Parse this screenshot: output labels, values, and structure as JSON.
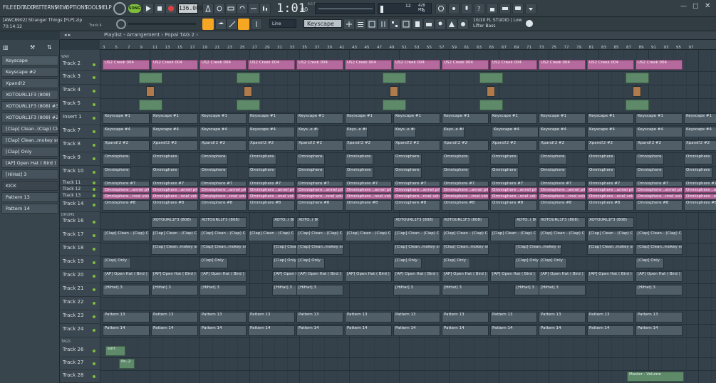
{
  "menu": [
    "FILE",
    "EDIT",
    "ADD",
    "PATTERNS",
    "VIEW",
    "OPTIONS",
    "TOOLS",
    "HELP"
  ],
  "transport": {
    "mode": "SONG",
    "tempo": "136.000",
    "time": "1:01",
    "time_sub": "00",
    "bst": "B:S:T"
  },
  "monitor": {
    "cpu": "12",
    "mem": "428 MB",
    "poly": "0"
  },
  "project": {
    "file": "[AWC8902] Stranger Things [FLP].zip",
    "time": "70:14:12",
    "track_hint": "Track 4"
  },
  "snap": "Line",
  "pattern": "Keyscape",
  "news": {
    "line1": "10/10 FL STUDIO | Low",
    "line2": "Lifter Bass"
  },
  "playlist_title": "Playlist - Arrangement › Popai TAG 2 ›",
  "browser_items": [
    "Keyscape",
    "Keyscape #2",
    "Xpand!2",
    "XOTOURL1F3 (808)",
    "XOTOURL1F3 (808) #3",
    "XOTOURL1F3 (808) #2",
    "[Clap] Clean..(Clap) Clean",
    "[Clap] Clean..mokey snare",
    "[Clap] Only",
    "[AP] Open Hat ( Bird )",
    "[HiHat] 3",
    "KICK",
    "Pattern 13",
    "Pattern 14"
  ],
  "ruler": [
    "3",
    "5",
    "7",
    "9",
    "11",
    "13",
    "15",
    "17",
    "19",
    "21",
    "23",
    "25",
    "27",
    "29",
    "31",
    "33",
    "35",
    "37",
    "39",
    "41",
    "43",
    "45",
    "47",
    "49",
    "51",
    "53",
    "55",
    "57",
    "59",
    "61",
    "63",
    "65",
    "67",
    "69",
    "71",
    "73",
    "75",
    "77",
    "79",
    "81",
    "83",
    "85",
    "87",
    "89",
    "91",
    "93",
    "95",
    "97"
  ],
  "sections": {
    "wav": "WAV",
    "drums": "DRUMS",
    "tags": "TAGS"
  },
  "tracks": [
    "Track 2",
    "Track 3",
    "Track 4",
    "Track 5",
    "Insert 1",
    "Track 7",
    "Track 8",
    "Track 9",
    "Track 10",
    "Track 11",
    "Track 12",
    "Track 13",
    "Track 14",
    "Track 16",
    "Track 17",
    "Track 18",
    "Track 19",
    "Track 20",
    "Track 21",
    "Track 22",
    "Track 23",
    "Track 24",
    "Track 26",
    "Track 27",
    "Track 28"
  ],
  "clips": {
    "t2": "US2 Creek 004",
    "ins1": "Keyscape #1",
    "t7": "Keyscape #4",
    "t7b": "Keys..e #4",
    "t8": "Xpand!2 #2",
    "t9": "Omnisphere #5",
    "t9b": "Omnis..ere #5",
    "t10": "Omnisphere #6",
    "t11": "Omnisphere #7",
    "t12": "Omnisphere ..annel pitch",
    "t13": "Omnisphere ..nnel volume",
    "t14": "Omnisphere #8",
    "t16": "XOTOURL1F3 (808)",
    "t16b": "XOTO..( 808) #3",
    "t17": "[Clap] Clean - (Clap) Clean",
    "t18": "[Clap] Clean..mokey snare",
    "t19": "[Clap] Only",
    "t20": "[AP] Open Hat ( Bird )",
    "t21": "[HiHat] 3",
    "t23": "Pattern 13",
    "t24": "Pattern 14",
    "t26": "sort",
    "t27": "Po..2",
    "t28": "Master - Volume"
  },
  "colors": {
    "accent": "#f5a623",
    "pink": "#b46a9c",
    "green": "#7fbf3c"
  }
}
